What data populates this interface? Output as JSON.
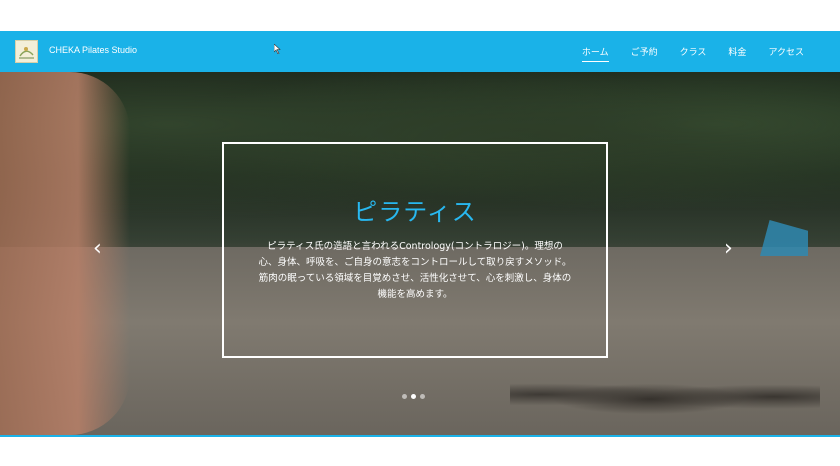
{
  "header": {
    "brand": "CHEKA Pilates Studio",
    "nav": [
      {
        "label": "ホーム",
        "active": true
      },
      {
        "label": "ご予約",
        "active": false
      },
      {
        "label": "クラス",
        "active": false
      },
      {
        "label": "料金",
        "active": false
      },
      {
        "label": "アクセス",
        "active": false
      }
    ]
  },
  "hero": {
    "title": "ピラティス",
    "line1": "ピラティス氏の造語と言われるContrology(コントラロジー)。理想の心、身体、呼吸を、ご自身の意志をコントロールして取り戻すメソッド。",
    "line2": "筋肉の眠っている領域を目覚めさせ、活性化させて、心を刺激し、身体の機能を高めます。",
    "prev_glyph": "‹",
    "next_glyph": "›",
    "slide_count": 3,
    "active_slide": 2
  },
  "colors": {
    "accent": "#1ab2e8",
    "title": "#28b8f0"
  }
}
